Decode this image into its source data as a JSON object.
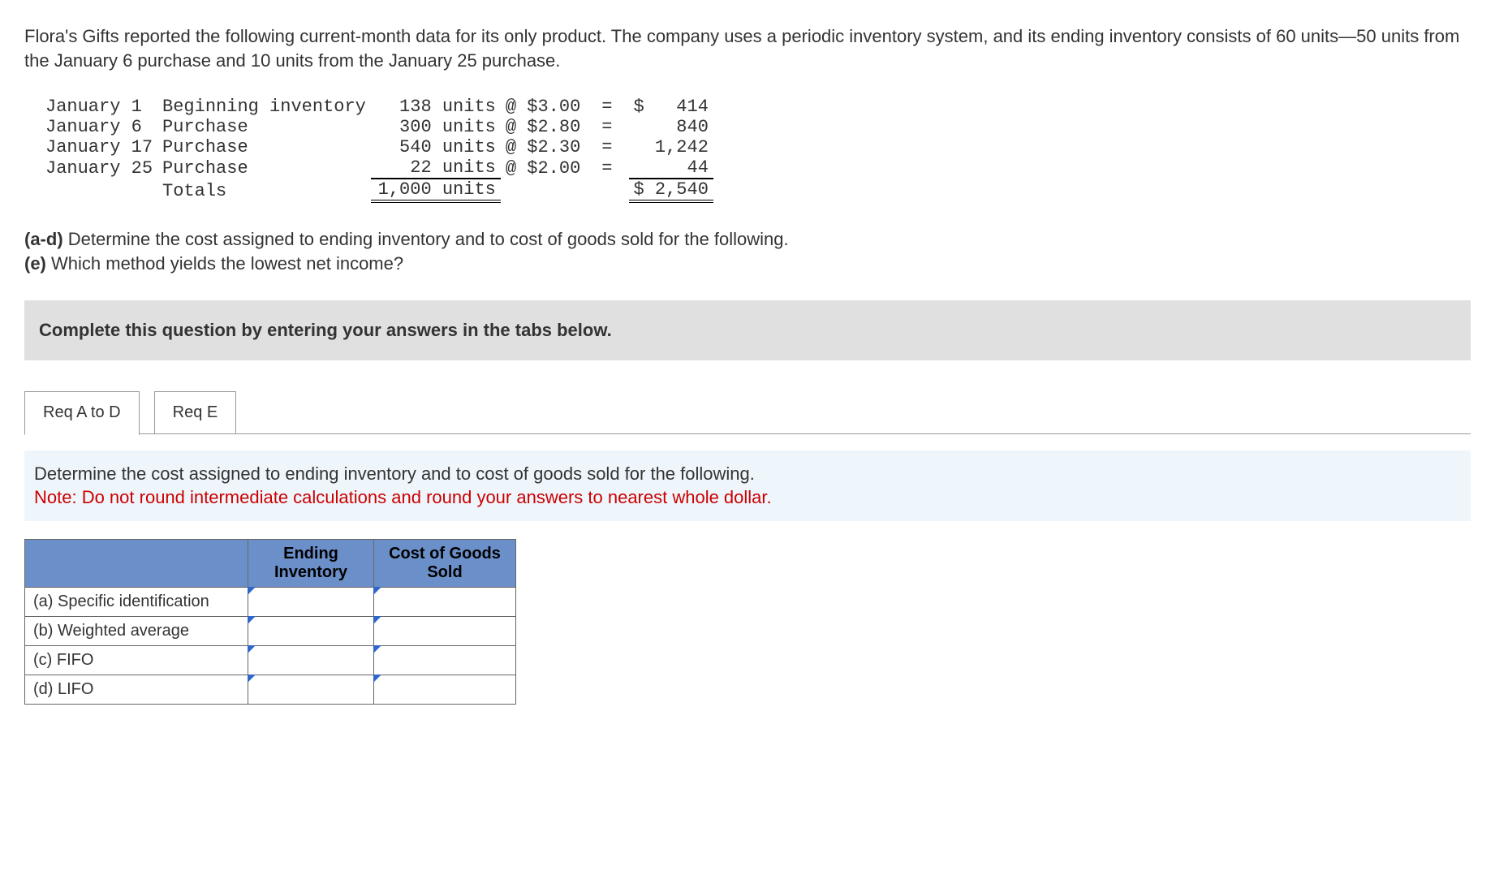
{
  "intro": "Flora's Gifts reported the following current-month data for its only product. The company uses a periodic inventory system, and its ending inventory consists of 60 units—50 units from the January 6 purchase and 10 units from the January 25 purchase.",
  "inventory": {
    "rows": [
      {
        "date": "January 1 ",
        "desc": "Beginning inventory",
        "units": "138 units",
        "price": "@ $3.00",
        "eq": "=",
        "amount": "$   414"
      },
      {
        "date": "January 6 ",
        "desc": "Purchase",
        "units": "300 units",
        "price": "@ $2.80",
        "eq": "=",
        "amount": "    840"
      },
      {
        "date": "January 17",
        "desc": "Purchase",
        "units": "540 units",
        "price": "@ $2.30",
        "eq": "=",
        "amount": "  1,242"
      },
      {
        "date": "January 25",
        "desc": "Purchase",
        "units": " 22 units",
        "price": "@ $2.00",
        "eq": "=",
        "amount": "     44"
      }
    ],
    "totals": {
      "desc": "Totals",
      "units": "1,000 units",
      "amount": "$ 2,540"
    }
  },
  "questions": {
    "ad_label": "(a-d)",
    "ad_text": " Determine the cost assigned to ending inventory and to cost of goods sold for the following.",
    "e_label": "(e)",
    "e_text": " Which method yields the lowest net income?"
  },
  "instruction": "Complete this question by entering your answers in the tabs below.",
  "tabs": {
    "tab1": "Req A to D",
    "tab2": "Req E"
  },
  "tab_desc": {
    "line1": "Determine the cost assigned to ending inventory and to cost of goods sold for the following.",
    "line2": "Note: Do not round intermediate calculations and round your answers to nearest whole dollar."
  },
  "answer_table": {
    "headers": {
      "col1": "Ending Inventory",
      "col2": "Cost of Goods Sold"
    },
    "rows": [
      {
        "label": "(a) Specific identification"
      },
      {
        "label": "(b) Weighted average"
      },
      {
        "label": "(c) FIFO"
      },
      {
        "label": "(d) LIFO"
      }
    ]
  }
}
